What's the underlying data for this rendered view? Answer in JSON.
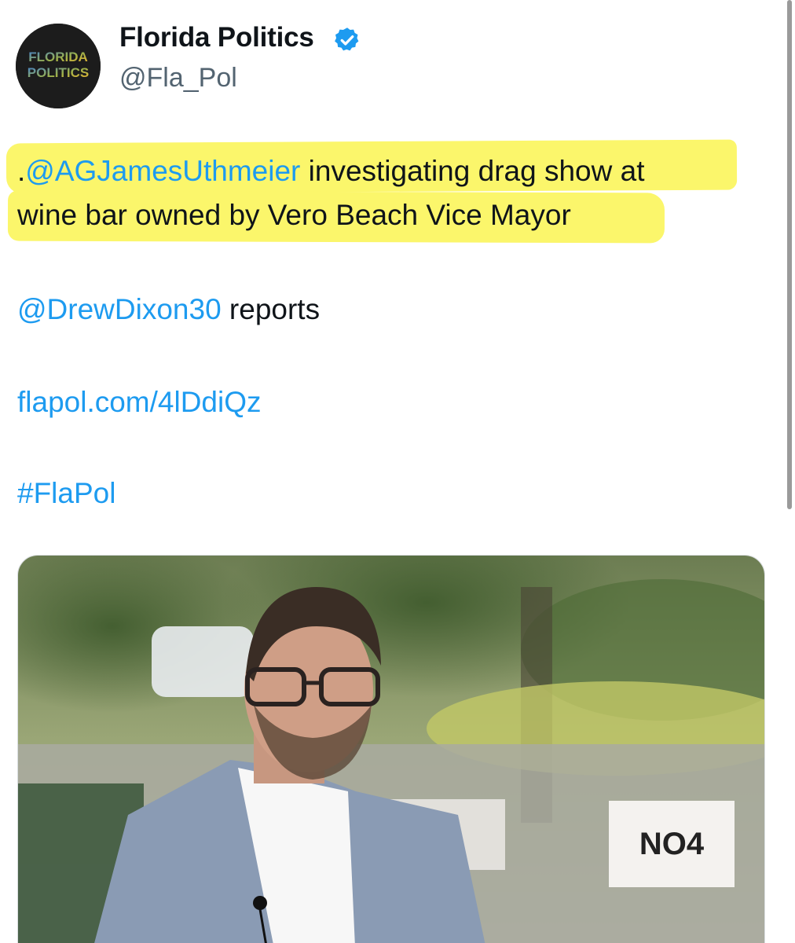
{
  "tweet": {
    "author": {
      "name": "Florida Politics",
      "handle": "@Fla_Pol",
      "verified": true,
      "avatar_text_line1": "FLORIDA",
      "avatar_text_line2": "POLITICS"
    },
    "body": {
      "line1_prefix": ".",
      "line1_mention": "@AGJamesUthmeier",
      "line1_rest": " investigating drag show at",
      "line2": "wine bar owned by Vero Beach Vice Mayor",
      "reporter_mention": "@DrewDixon30",
      "reporter_rest": " reports",
      "link": "flapol.com/4lDdiQz",
      "hashtag": "#FlaPol"
    },
    "media": {
      "sign_text": "NO4"
    },
    "colors": {
      "link": "#1d9bf0",
      "highlight": "#fbf66b",
      "verified": "#1d9bf0"
    }
  }
}
